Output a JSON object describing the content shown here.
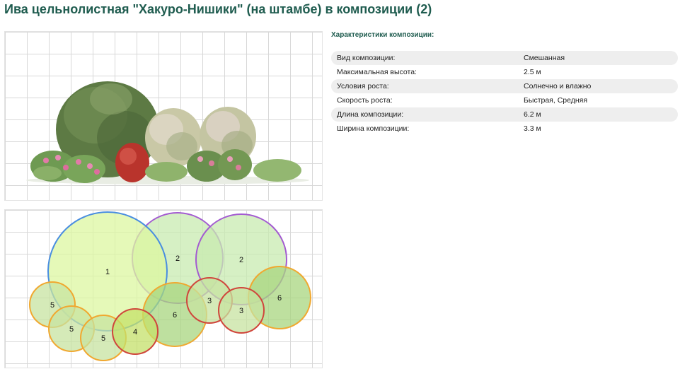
{
  "page": {
    "title": "Ива цельнолистная \"Хакуро-Нишики\" (на штамбе) в композиции (2)"
  },
  "specs": {
    "heading": "Характеристики композиции:",
    "rows": [
      {
        "label": "Вид композиции:",
        "value": "Смешанная"
      },
      {
        "label": "Максимальная высота:",
        "value": "2.5 м"
      },
      {
        "label": "Условия роста:",
        "value": "Солнечно и влажно"
      },
      {
        "label": "Скорость роста:",
        "value": "Быстрая, Средняя"
      },
      {
        "label": "Длина композиции:",
        "value": "6.2 м"
      },
      {
        "label": "Ширина композиции:",
        "value": "3.3 м"
      }
    ]
  },
  "plan": {
    "plants": [
      {
        "number": "2",
        "fill": "#c8ebb0",
        "stroke": "#a35bd1"
      },
      {
        "number": "2",
        "fill": "#c8ebb0",
        "stroke": "#a35bd1"
      },
      {
        "number": "1",
        "fill": "#dcf7a0",
        "stroke": "#4a8ee0"
      },
      {
        "number": "5",
        "fill": "#c7e3a0",
        "stroke": "#f0a830"
      },
      {
        "number": "5",
        "fill": "#c7e3a0",
        "stroke": "#f0a830"
      },
      {
        "number": "5",
        "fill": "#c7e3a0",
        "stroke": "#f0a830"
      },
      {
        "number": "6",
        "fill": "#a8d67f",
        "stroke": "#f0a830"
      },
      {
        "number": "6",
        "fill": "#a8d67f",
        "stroke": "#f0a830"
      },
      {
        "number": "3",
        "fill": "#c7e3a0",
        "stroke": "#d0463c"
      },
      {
        "number": "3",
        "fill": "#c7e3a0",
        "stroke": "#d0463c"
      },
      {
        "number": "4",
        "fill": "#c4e06a",
        "stroke": "#d0463c"
      }
    ]
  }
}
